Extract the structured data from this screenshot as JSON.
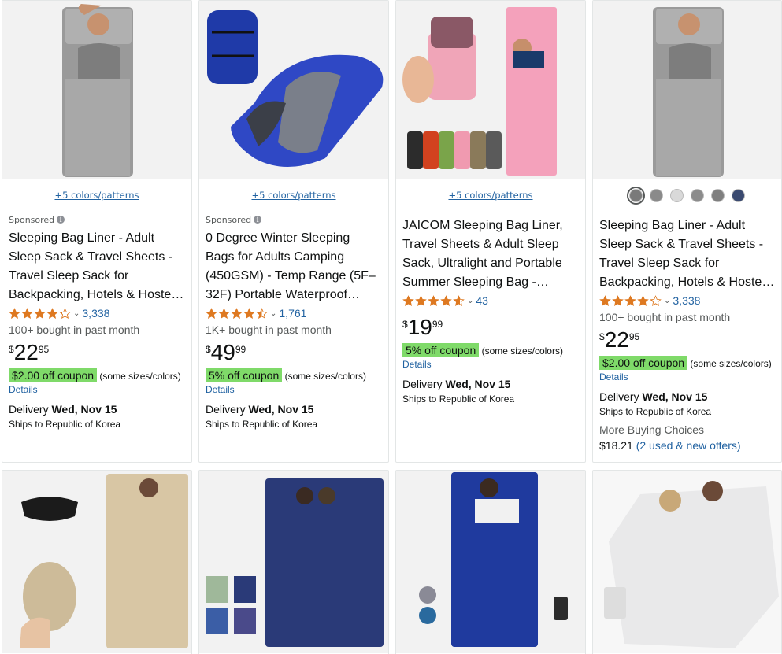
{
  "products": [
    {
      "swatch_link": "+5 colors/patterns",
      "sponsored": "Sponsored",
      "title": "Sleeping Bag Liner - Adult Sleep Sack & Travel Sheets - Travel Sleep Sack for Backpacking, Hotels & Hoste…",
      "rating": 4.2,
      "review_count": "3,338",
      "bought": "100+ bought in past month",
      "price_symbol": "$",
      "price_whole": "22",
      "price_fraction": "95",
      "coupon": "$2.00 off coupon",
      "coupon_note": "(some sizes/colors)",
      "details": "Details",
      "delivery_label": "Delivery",
      "delivery_date": "Wed, Nov 15",
      "ships": "Ships to Republic of Korea"
    },
    {
      "swatch_link": "+5 colors/patterns",
      "sponsored": "Sponsored",
      "title": "0 Degree Winter Sleeping Bags for Adults Camping (450GSM) - Temp Range (5F–32F) Portable Waterproof…",
      "rating": 4.5,
      "review_count": "1,761",
      "bought": "1K+ bought in past month",
      "price_symbol": "$",
      "price_whole": "49",
      "price_fraction": "99",
      "coupon": "5% off coupon",
      "coupon_note": "(some sizes/colors)",
      "details": "Details",
      "delivery_label": "Delivery",
      "delivery_date": "Wed, Nov 15",
      "ships": "Ships to Republic of Korea"
    },
    {
      "swatch_link": "+5 colors/patterns",
      "title": "JAICOM Sleeping Bag Liner, Travel Sheets & Adult Sleep Sack, Ultralight and Portable Summer Sleeping Bag - Ideal…",
      "rating": 4.6,
      "review_count": "43",
      "price_symbol": "$",
      "price_whole": "19",
      "price_fraction": "99",
      "coupon": "5% off coupon",
      "coupon_note": "(some sizes/colors)",
      "details": "Details",
      "delivery_label": "Delivery",
      "delivery_date": "Wed, Nov 15",
      "ships": "Ships to Republic of Korea"
    },
    {
      "title": "Sleeping Bag Liner - Adult Sleep Sack & Travel Sheets - Travel Sleep Sack for Backpacking, Hotels & Hoste…",
      "rating": 4.2,
      "review_count": "3,338",
      "bought": "100+ bought in past month",
      "price_symbol": "$",
      "price_whole": "22",
      "price_fraction": "95",
      "coupon": "$2.00 off coupon",
      "coupon_note": "(some sizes/colors)",
      "details": "Details",
      "delivery_label": "Delivery",
      "delivery_date": "Wed, Nov 15",
      "ships": "Ships to Republic of Korea",
      "more_buying": "More Buying Choices",
      "more_price": "$18.21",
      "more_offers": "(2 used & new offers)",
      "swatch_colors": [
        "#7a7a7a",
        "#8a8a8a",
        "#d9d9d9",
        "#8c8c8c",
        "#7f7f7f",
        "#3a4a70"
      ]
    }
  ],
  "colors": {
    "link": "#2162a1",
    "coupon_bg": "#7fda69",
    "star": "#de7921"
  }
}
